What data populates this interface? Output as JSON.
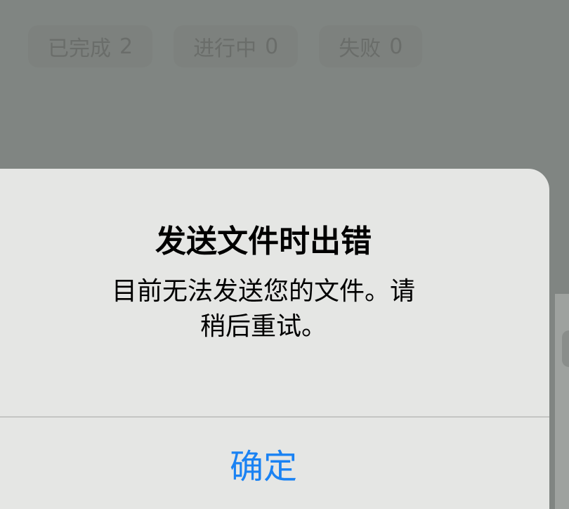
{
  "tabs": [
    {
      "label": "已完成",
      "count": "2"
    },
    {
      "label": "进行中",
      "count": "0"
    },
    {
      "label": "失败",
      "count": "0"
    }
  ],
  "alert": {
    "title": "发送文件时出错",
    "message_line1": "目前无法发送您的文件。请",
    "message_line2": "稍后重试。",
    "confirm_label": "确定"
  },
  "colors": {
    "accent": "#1a82f3",
    "dim_background": "#808582",
    "alert_background": "#e5e6e4"
  }
}
